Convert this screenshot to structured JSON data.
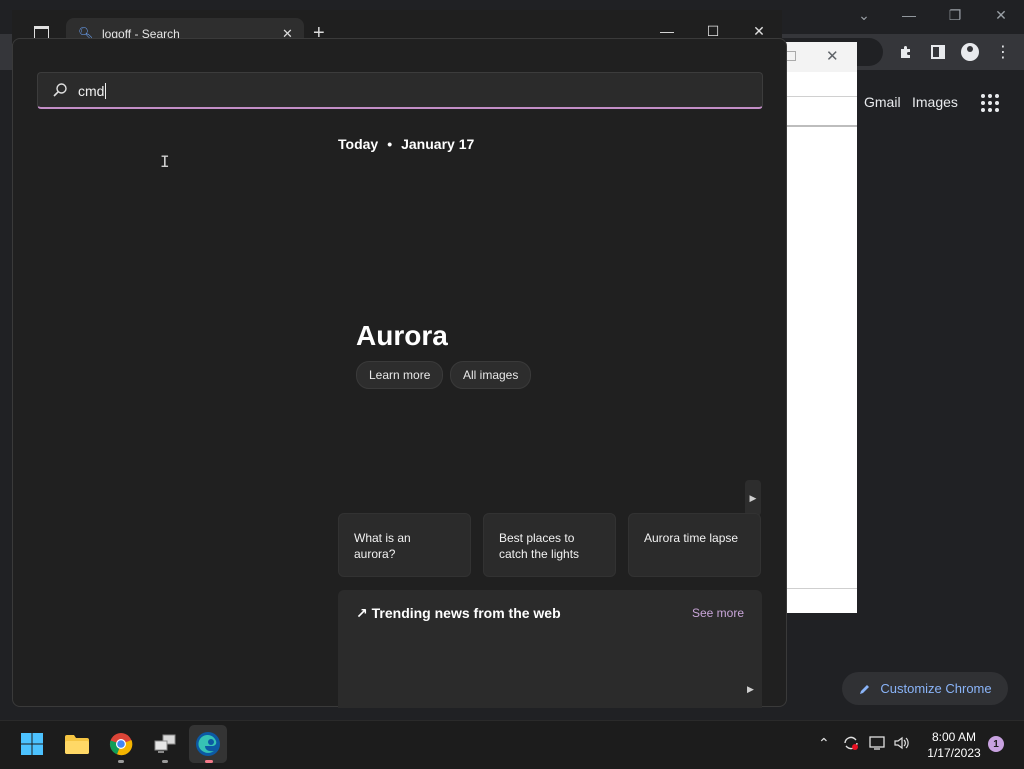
{
  "chrome": {
    "gmail_label": "Gmail",
    "images_label": "Images",
    "customize_label": "Customize Chrome"
  },
  "edge": {
    "tab_title": "logoff - Search"
  },
  "search": {
    "query": "cmd"
  },
  "feed": {
    "today_label": "Today",
    "separator": "•",
    "date_label": "January 17",
    "hero_title": "Aurora",
    "buttons": [
      "Learn more",
      "All images"
    ],
    "suggestions": [
      {
        "line1": "What is an aurora?",
        "line2": ""
      },
      {
        "line1": "Best places to",
        "line2": "catch the lights"
      },
      {
        "line1": "Aurora time lapse",
        "line2": ""
      }
    ],
    "trending_title": "Trending news from the web",
    "see_more_label": "See more"
  },
  "taskbar": {
    "time": "8:00 AM",
    "date": "1/17/2023",
    "notification_count": "1"
  },
  "colors": {
    "accent": "#c38ec7",
    "see_more": "#c8a5d8",
    "chrome_link": "#8ab4f8"
  }
}
